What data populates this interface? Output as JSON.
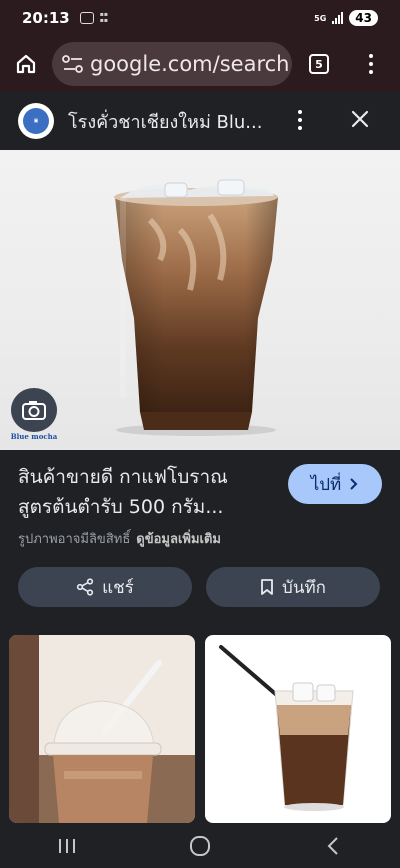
{
  "status_bar": {
    "time": "20:13",
    "network": "5G",
    "battery": "43"
  },
  "browser": {
    "url": "google.com/search",
    "tab_count": "5"
  },
  "viewer": {
    "site_title": "โรงคั่วชาเชียงใหม่ Blu...",
    "watermark_text": "Blue mocha"
  },
  "product": {
    "title_line1": "สินค้าขายดี กาแฟโบราณ",
    "title_line2": "สูตรต้นตำรับ 500 กรัม...",
    "visit_label": "ไปที่",
    "rights_text": "รูปภาพอาจมีลิขสิทธิ์",
    "more_info_label": "ดูข้อมูลเพิ่มเติม",
    "share_label": "แชร์",
    "save_label": "บันทึก"
  }
}
